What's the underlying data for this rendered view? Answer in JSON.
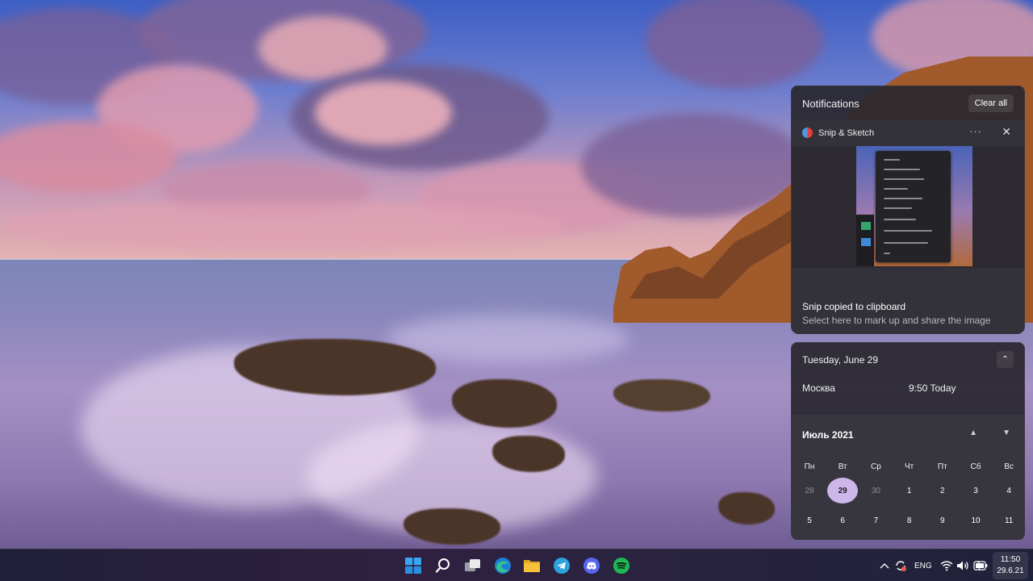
{
  "notifications": {
    "header": "Notifications",
    "clear_all": "Clear all",
    "toast": {
      "app_name": "Snip & Sketch",
      "more": "···",
      "close": "✕",
      "title": "Snip copied to clipboard",
      "subtitle": "Select here to mark up and share the image"
    }
  },
  "calendar": {
    "date_heading": "Tuesday, June 29",
    "collapse": "⌃",
    "clock": {
      "city": "Москва",
      "time": "9:50 Today"
    },
    "month_label": "Июль 2021",
    "nav_up": "▲",
    "nav_down": "▼",
    "weekdays": [
      "Пн",
      "Вт",
      "Ср",
      "Чт",
      "Пт",
      "Сб",
      "Вс"
    ],
    "weeks": [
      [
        {
          "d": "28",
          "muted": true
        },
        {
          "d": "29",
          "today": true
        },
        {
          "d": "30",
          "muted": true
        },
        {
          "d": "1"
        },
        {
          "d": "2"
        },
        {
          "d": "3"
        },
        {
          "d": "4"
        }
      ],
      [
        {
          "d": "5"
        },
        {
          "d": "6"
        },
        {
          "d": "7"
        },
        {
          "d": "8"
        },
        {
          "d": "9"
        },
        {
          "d": "10"
        },
        {
          "d": "11"
        }
      ]
    ]
  },
  "taskbar": {
    "apps": [
      "start-icon",
      "search-icon",
      "task-view-icon",
      "edge-icon",
      "file-explorer-icon",
      "telegram-icon",
      "discord-icon",
      "spotify-icon"
    ],
    "tray": {
      "language": "ENG",
      "time": "11:50",
      "date": "29.6.21"
    }
  },
  "colors": {
    "accent": "#cdb6e8",
    "panel_bg": "#28262e",
    "spotify": "#1db954",
    "discord": "#5865f2",
    "telegram": "#2aa3de",
    "folder": "#f5c23a"
  }
}
